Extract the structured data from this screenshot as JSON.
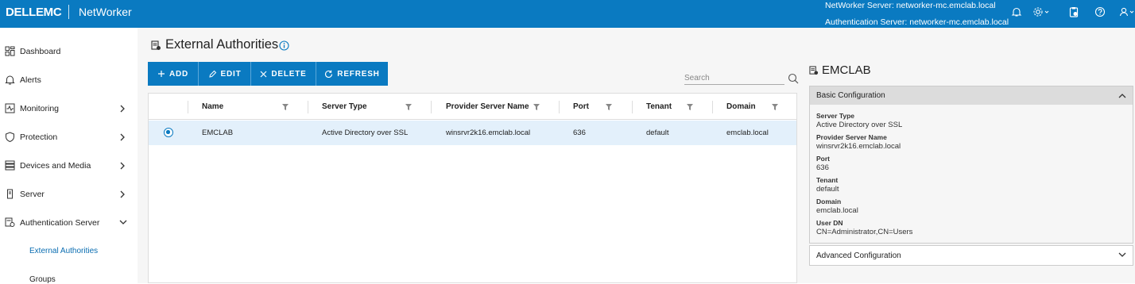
{
  "header": {
    "brand": "DELLEMC",
    "product": "NetWorker",
    "networker_server": "NetWorker Server: networker-mc.emclab.local",
    "auth_server": "Authentication Server: networker-mc.emclab.local",
    "icons": [
      "bell-icon",
      "gear-icon",
      "clipboard-icon",
      "help-icon",
      "user-icon"
    ]
  },
  "sidebar": {
    "items": [
      {
        "label": "Dashboard",
        "icon": "dashboard-icon"
      },
      {
        "label": "Alerts",
        "icon": "bell-icon"
      },
      {
        "label": "Monitoring",
        "icon": "monitor-icon"
      },
      {
        "label": "Protection",
        "icon": "shield-icon"
      },
      {
        "label": "Devices and Media",
        "icon": "storage-icon"
      },
      {
        "label": "Server",
        "icon": "server-icon"
      },
      {
        "label": "Authentication Server",
        "icon": "auth-server-icon"
      }
    ],
    "sub_items": [
      {
        "label": "External Authorities",
        "active": true
      },
      {
        "label": "Groups",
        "active": false
      }
    ]
  },
  "main": {
    "title": "External Authorities",
    "toolbar": {
      "add": "ADD",
      "edit": "EDIT",
      "delete": "DELETE",
      "refresh": "REFRESH"
    },
    "search": {
      "placeholder": "Search",
      "value": ""
    },
    "table": {
      "columns": [
        "Name",
        "Server Type",
        "Provider Server Name",
        "Port",
        "Tenant",
        "Domain"
      ],
      "rows": [
        {
          "selected": true,
          "cells": [
            "EMCLAB",
            "Active Directory over SSL",
            "winsrvr2k16.emclab.local",
            "636",
            "default",
            "emclab.local"
          ]
        }
      ]
    }
  },
  "detail": {
    "title": "EMCLAB",
    "basic_header": "Basic Configuration",
    "fields": [
      {
        "label": "Server Type",
        "value": "Active Directory over SSL"
      },
      {
        "label": "Provider Server Name",
        "value": "winsrvr2k16.emclab.local"
      },
      {
        "label": "Port",
        "value": "636"
      },
      {
        "label": "Tenant",
        "value": "default"
      },
      {
        "label": "Domain",
        "value": "emclab.local"
      },
      {
        "label": "User DN",
        "value": "CN=Administrator,CN=Users"
      }
    ],
    "advanced_header": "Advanced Configuration"
  },
  "colors": {
    "accent": "#0a7ac1",
    "active_text": "#0a6db1",
    "row_selected": "#e3f0fb"
  }
}
